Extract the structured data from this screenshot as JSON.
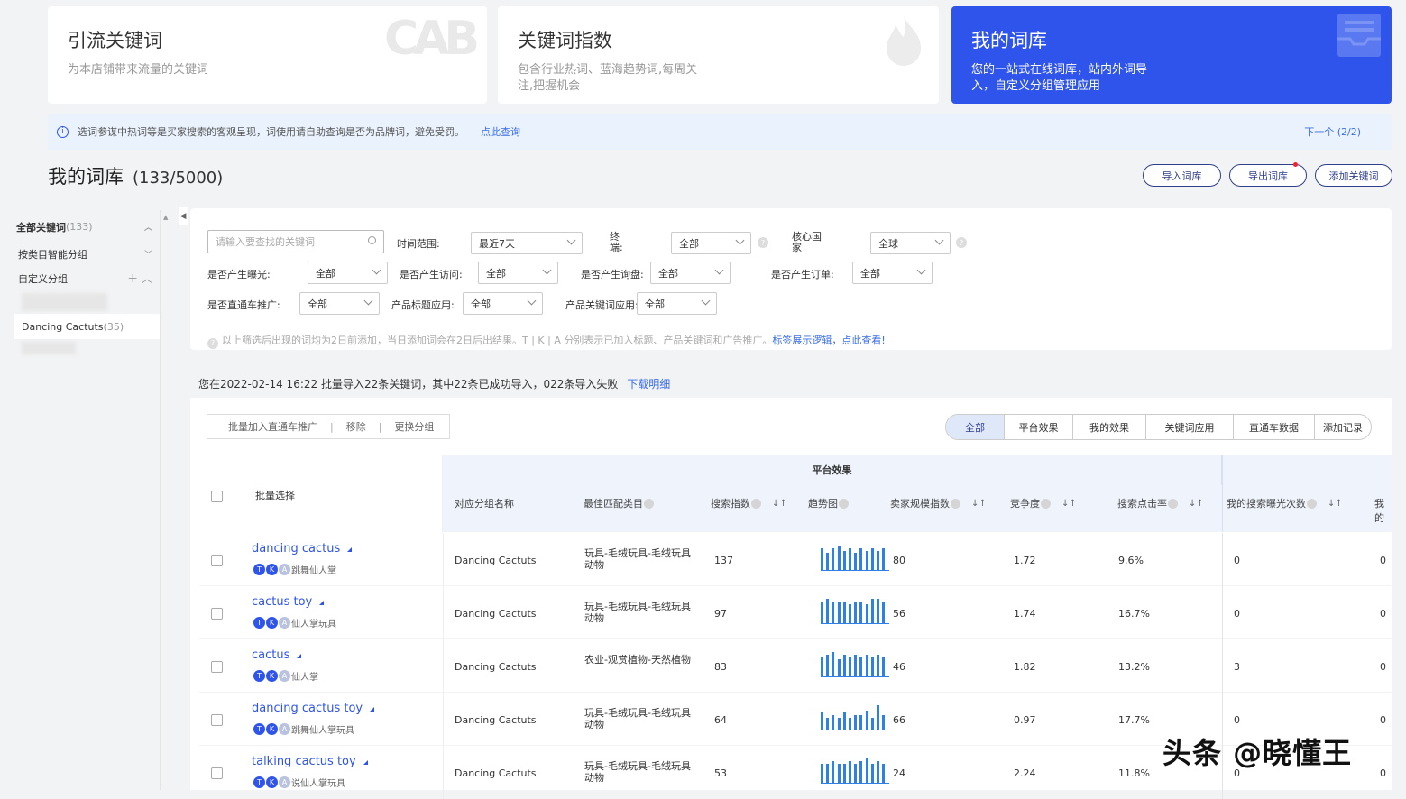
{
  "cards": [
    {
      "title": "引流关键词",
      "desc": "为本店铺带来流量的关键词",
      "icon": "CAB"
    },
    {
      "title": "关键词指数",
      "desc": "包含行业热词、蓝海趋势词,每周关注,把握机会",
      "icon": "flame-icon"
    },
    {
      "title": "我的词库",
      "desc": "您的一站式在线词库，站内外词导入，自定义分组管理应用",
      "icon": "inbox-icon"
    }
  ],
  "notice": {
    "text": "选词参谋中热词等是买家搜索的客观呈现，词使用请自助查询是否为品牌词，避免受罚。",
    "link": "点此查询",
    "next": "下一个 (2/2)"
  },
  "page": {
    "title": "我的词库",
    "count": "(133/5000)"
  },
  "buttons": {
    "import": "导入词库",
    "export": "导出词库",
    "add": "添加关键词"
  },
  "sidebar": {
    "all": "全部关键词",
    "all_count": "(133)",
    "smart": "按类目智能分组",
    "custom": "自定义分组",
    "group": "Dancing Cactuts",
    "group_count": "(35)"
  },
  "filters": {
    "search_placeholder": "请输入要查找的关键词",
    "time_label": "时间范围:",
    "time_value": "最近7天",
    "terminal_label": "终端:",
    "terminal_value": "全部",
    "country_label": "核心国家",
    "country_value": "全球",
    "exposure_label": "是否产生曝光:",
    "exposure_value": "全部",
    "visit_label": "是否产生访问:",
    "visit_value": "全部",
    "inquiry_label": "是否产生询盘:",
    "inquiry_value": "全部",
    "order_label": "是否产生订单:",
    "order_value": "全部",
    "p4p_label": "是否直通车推广:",
    "p4p_value": "全部",
    "title_label": "产品标题应用:",
    "title_value": "全部",
    "prodkw_label": "产品关键词应用:",
    "prodkw_value": "全部",
    "note": "以上筛选后出现的词均为2日前添加，当日添加词会在2日后出结果。T | K | A 分别表示已加入标题、产品关键词和广告推广。",
    "note_link": "标签展示逻辑，点此查看!"
  },
  "import_msg": {
    "text": "您在2022-02-14 16:22 批量导入22条关键词，其中22条已成功导入，022条导入失败",
    "link": "下载明细"
  },
  "batch": {
    "p4p": "批量加入直通车推广",
    "remove": "移除",
    "change": "更换分组"
  },
  "tabs": [
    "全部",
    "平台效果",
    "我的效果",
    "关键词应用",
    "直通车数据",
    "添加记录"
  ],
  "table": {
    "batch_select": "批量选择",
    "group_header": "平台效果",
    "columns": {
      "group": "对应分组名称",
      "category": "最佳匹配类目",
      "search_idx": "搜索指数",
      "trend": "趋势图",
      "seller_idx": "卖家规模指数",
      "competition": "竞争度",
      "ctr": "搜索点击率",
      "my_exposure": "我的搜索曝光次数",
      "my_more": "我的"
    },
    "rows": [
      {
        "kw": "dancing cactus",
        "cn": "跳舞仙人掌",
        "group": "Dancing Cactuts",
        "category": "玩具-毛绒玩具-毛绒玩具动物",
        "search": "137",
        "seller": "80",
        "comp": "1.72",
        "ctr": "9.6%",
        "expo": "0",
        "more": "0",
        "trend": [
          0.9,
          0.7,
          0.9,
          1.0,
          0.8,
          0.9,
          0.7,
          0.9,
          0.8,
          0.9,
          0.8,
          0.9
        ]
      },
      {
        "kw": "cactus toy",
        "cn": "仙人掌玩具",
        "group": "Dancing Cactuts",
        "category": "玩具-毛绒玩具-毛绒玩具动物",
        "search": "97",
        "seller": "56",
        "comp": "1.74",
        "ctr": "16.7%",
        "expo": "0",
        "more": "0",
        "trend": [
          0.9,
          1.0,
          0.9,
          0.9,
          0.9,
          0.8,
          0.9,
          0.9,
          0.8,
          1.0,
          1.0,
          0.9
        ]
      },
      {
        "kw": "cactus",
        "cn": "仙人掌",
        "group": "Dancing Cactuts",
        "category": "农业-观赏植物-天然植物",
        "search": "83",
        "seller": "46",
        "comp": "1.82",
        "ctr": "13.2%",
        "expo": "3",
        "more": "0",
        "trend": [
          0.8,
          0.9,
          1.0,
          0.7,
          0.9,
          0.8,
          0.9,
          0.8,
          0.9,
          0.8,
          0.9,
          0.8
        ]
      },
      {
        "kw": "dancing cactus toy",
        "cn": "跳舞仙人掌玩具",
        "group": "Dancing Cactuts",
        "category": "玩具-毛绒玩具-毛绒玩具动物",
        "search": "64",
        "seller": "66",
        "comp": "0.97",
        "ctr": "17.7%",
        "expo": "0",
        "more": "0",
        "trend": [
          0.7,
          0.5,
          0.6,
          0.5,
          0.7,
          0.5,
          0.6,
          0.6,
          0.8,
          0.5,
          1.0,
          0.6
        ]
      },
      {
        "kw": "talking cactus toy",
        "cn": "说仙人掌玩具",
        "group": "Dancing Cactuts",
        "category": "玩具-毛绒玩具-毛绒玩具动物",
        "search": "53",
        "seller": "24",
        "comp": "2.24",
        "ctr": "11.8%",
        "expo": "0",
        "more": "0",
        "trend": [
          0.8,
          0.8,
          0.9,
          0.8,
          0.8,
          0.9,
          0.8,
          0.9,
          1.0,
          0.8,
          0.9,
          0.8
        ]
      }
    ]
  },
  "watermark": "头条 @晓懂王",
  "colors": {
    "accent": "#2f54eb",
    "link": "#3a6ee8",
    "badge_t": "#2f54eb",
    "badge_k": "#2f54eb",
    "badge_a": "#b9c2de"
  }
}
